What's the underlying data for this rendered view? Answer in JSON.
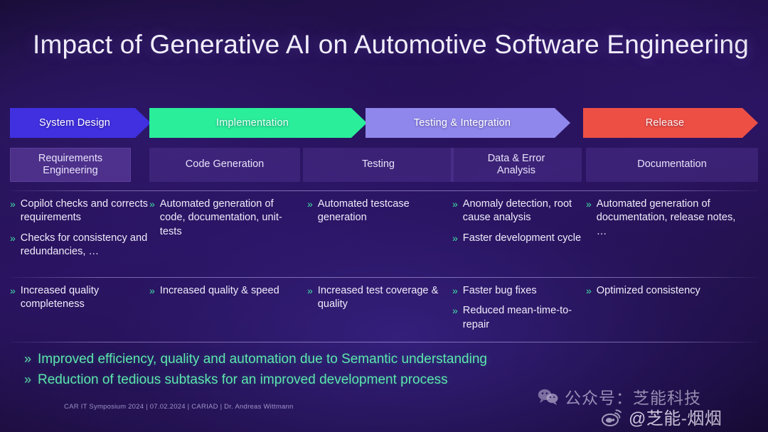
{
  "slide": {
    "title": "Impact of Generative AI on Automotive Software Engineering",
    "footer": "CAR IT Symposium 2024 | 07.02.2024 | CARIAD | Dr. Andreas Wittmann",
    "bullet_marker": "»"
  },
  "colors": {
    "background_deep": "#1d0f3f",
    "background_mid": "#2a1360",
    "phase_system_design": "#4030E0",
    "phase_implementation": "#2AEE9A",
    "phase_testing_integration": "#9087EC",
    "phase_release": "#EE4F45",
    "bullet_chevron": "#3fe3a4",
    "summary_text": "#5ce7ae",
    "title_text": "#f2eefc",
    "category_panel": "rgba(124,86,196,0.22)"
  },
  "phases": [
    {
      "label": "System Design",
      "color": "#4030E0",
      "text_color": "#ffffff"
    },
    {
      "label": "Implementation",
      "color": "#2AEE9A",
      "text_color": "#eafff6"
    },
    {
      "label": "Testing & Integration",
      "color": "#9087EC",
      "text_color": "#ffffff"
    },
    {
      "label": "Release",
      "color": "#EE4F45",
      "text_color": "#fff0ee"
    }
  ],
  "categories": [
    {
      "label": "Requirements\nEngineering",
      "highlighted": true
    },
    {
      "label": "Code Generation",
      "highlighted": false
    },
    {
      "label": "Testing",
      "highlighted": false
    },
    {
      "label": "Data & Error\nAnalysis",
      "highlighted": false
    },
    {
      "label": "Documentation",
      "highlighted": false
    }
  ],
  "rows": [
    {
      "name": "capabilities",
      "columns": [
        {
          "bullets": [
            "Copilot checks and corrects requirements",
            "Checks for consistency and redundancies, …"
          ]
        },
        {
          "bullets": [
            "Automated generation of code, documentation, unit-tests"
          ]
        },
        {
          "bullets": [
            "Automated testcase generation"
          ]
        },
        {
          "bullets": [
            "Anomaly detection, root cause analysis",
            "Faster development cycle"
          ]
        },
        {
          "bullets": [
            "Automated generation of documentation, release notes, …"
          ]
        }
      ]
    },
    {
      "name": "benefits",
      "columns": [
        {
          "bullets": [
            "Increased quality completeness"
          ]
        },
        {
          "bullets": [
            "Increased quality & speed"
          ]
        },
        {
          "bullets": [
            "Increased test coverage & quality"
          ]
        },
        {
          "bullets": [
            "Faster bug fixes",
            "Reduced mean-time-to-repair"
          ]
        },
        {
          "bullets": [
            "Optimized consistency"
          ]
        }
      ]
    }
  ],
  "summary": [
    "Improved efficiency, quality and automation due to Semantic understanding",
    "Reduction of tedious subtasks for an improved development process"
  ],
  "watermarks": {
    "wechat": {
      "icon": "wechat-icon",
      "text": "公众号：芝能科技"
    },
    "weibo": {
      "icon": "weibo-icon",
      "text": "@芝能-烟烟"
    }
  }
}
